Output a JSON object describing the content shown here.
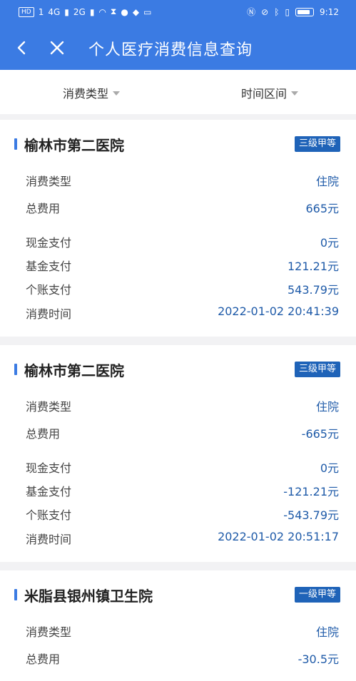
{
  "status_bar": {
    "left_chip": "HD",
    "sim1": "1",
    "net1": "4G",
    "net2": "2G",
    "time": "9:12"
  },
  "nav": {
    "title": "个人医疗消费信息查询"
  },
  "filters": [
    {
      "label": "消费类型"
    },
    {
      "label": "时间区间"
    }
  ],
  "records": [
    {
      "hospital": "榆林市第二医院",
      "grade": "三级甲等",
      "rows": [
        {
          "label": "消费类型",
          "value": "住院"
        },
        {
          "label": "总费用",
          "value": "665元"
        },
        {
          "label": "现金支付",
          "value": "0元"
        },
        {
          "label": "基金支付",
          "value": "121.21元"
        },
        {
          "label": "个账支付",
          "value": "543.79元"
        },
        {
          "label": "消费时间",
          "value": "2022-01-02 20:41:39"
        }
      ]
    },
    {
      "hospital": "榆林市第二医院",
      "grade": "三级甲等",
      "rows": [
        {
          "label": "消费类型",
          "value": "住院"
        },
        {
          "label": "总费用",
          "value": "-665元"
        },
        {
          "label": "现金支付",
          "value": "0元"
        },
        {
          "label": "基金支付",
          "value": "-121.21元"
        },
        {
          "label": "个账支付",
          "value": "-543.79元"
        },
        {
          "label": "消费时间",
          "value": "2022-01-02 20:51:17"
        }
      ]
    },
    {
      "hospital": "米脂县银州镇卫生院",
      "grade": "一级甲等",
      "rows": [
        {
          "label": "消费类型",
          "value": "住院"
        },
        {
          "label": "总费用",
          "value": "-30.5元"
        }
      ]
    }
  ],
  "colors": {
    "primary": "#3b7be3",
    "badge": "#1f63b8",
    "value_text": "#1e5aa8"
  }
}
